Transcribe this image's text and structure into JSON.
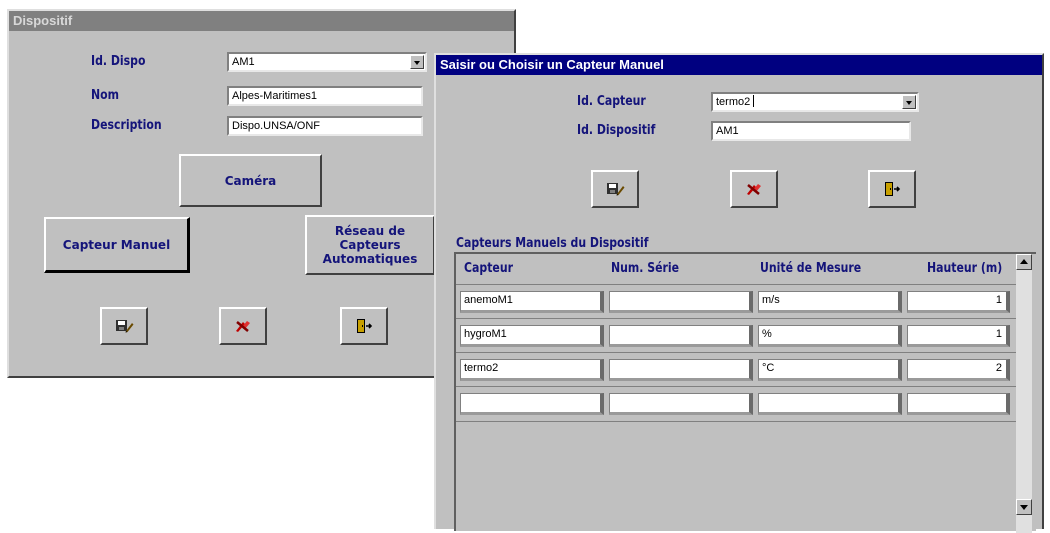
{
  "dispositif_window": {
    "title": "Dispositif",
    "labels": {
      "id": "Id. Dispo",
      "nom": "Nom",
      "description": "Description"
    },
    "values": {
      "id": "AM1",
      "nom": "Alpes-Maritimes1",
      "description": "Dispo.UNSA/ONF"
    },
    "buttons": {
      "camera": "Caméra",
      "capteur_manuel": "Capteur Manuel",
      "reseau_line1": "Réseau de",
      "reseau_line2": "Capteurs",
      "reseau_line3": "Automatiques"
    },
    "toolbar_icons": [
      "save-icon",
      "delete-icon",
      "exit-door-icon"
    ]
  },
  "capteur_window": {
    "title": "Saisir ou Choisir un Capteur Manuel",
    "labels": {
      "id_capteur": "Id. Capteur",
      "id_dispositif": "Id. Dispositif"
    },
    "values": {
      "id_capteur": "termo2",
      "id_dispositif": "AM1"
    },
    "toolbar_icons": [
      "save-icon",
      "delete-icon",
      "exit-door-icon"
    ],
    "subform": {
      "title": "Capteurs Manuels du Dispositif",
      "columns": [
        "Capteur",
        "Num. Série",
        "Unité de Mesure",
        "Hauteur (m)"
      ],
      "rows": [
        {
          "capteur": "anemoM1",
          "num_serie": "",
          "unite": "m/s",
          "hauteur": "1"
        },
        {
          "capteur": "hygroM1",
          "num_serie": "",
          "unite": "%",
          "hauteur": "1"
        },
        {
          "capteur": "termo2",
          "num_serie": "",
          "unite": "°C",
          "hauteur": "2"
        },
        {
          "capteur": "",
          "num_serie": "",
          "unite": "",
          "hauteur": ""
        }
      ]
    }
  },
  "colors": {
    "face": "#c0c0c0",
    "label": "#14147a",
    "title_active": "#000080",
    "title_inactive": "#808080"
  }
}
